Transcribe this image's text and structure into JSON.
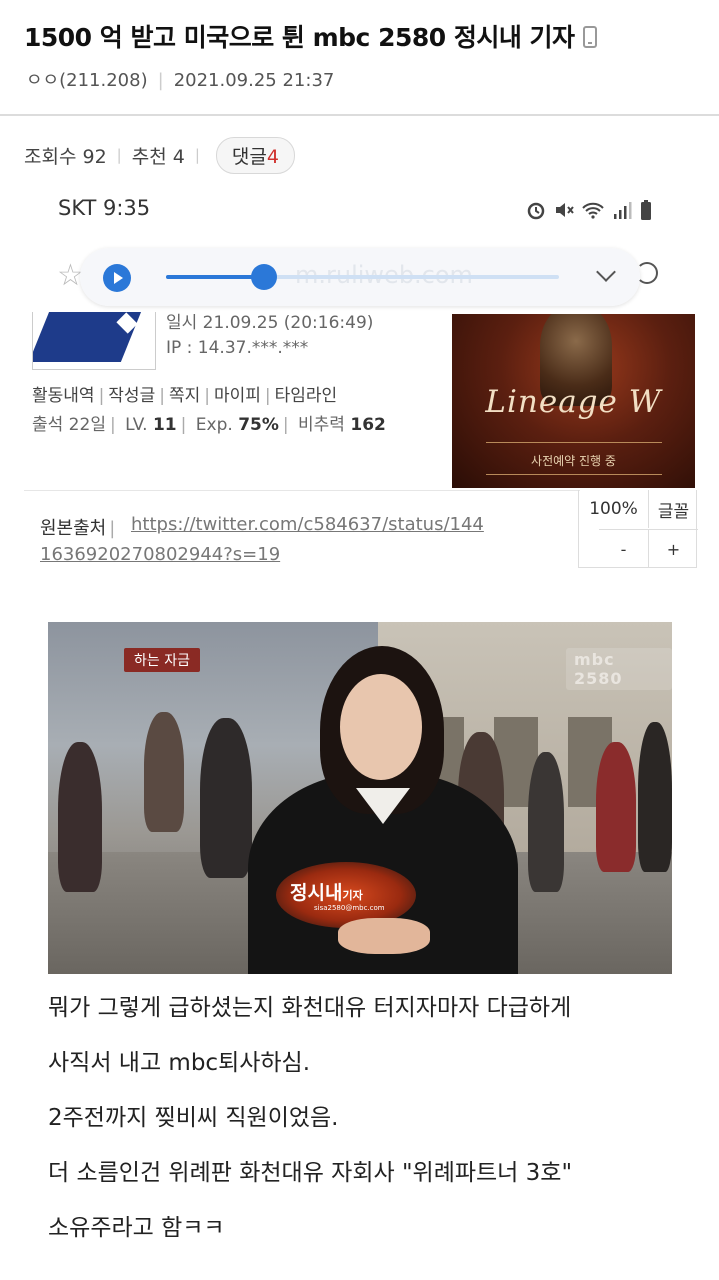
{
  "post": {
    "title": "1500 억 받고 미국으로 튄 mbc 2580 정시내 기자",
    "author": "ㅇㅇ(211.208)",
    "datetime": "2021.09.25 21:37",
    "views_label": "조회수 92",
    "recommend_label": "추천 4",
    "comment_label": "댓글",
    "comment_count": "4"
  },
  "embedded_screenshot": {
    "carrier_time": "SKT 9:35",
    "player": {
      "watermark": "m.ruliweb.com",
      "progress": 0.25
    },
    "profile": {
      "date": "일시 21.09.25 (20:16:49)",
      "ip": "IP : 14.37.***.***",
      "links": [
        "활동내역",
        "작성글",
        "쪽지",
        "마이피",
        "타임라인"
      ],
      "attendance": "출석 22일",
      "level_label": "LV.",
      "level": "11",
      "exp_label": "Exp.",
      "exp": "75%",
      "power_label": "비추력",
      "power": "162"
    },
    "ad": {
      "logo": "Lineage W",
      "subtext": "사전예약 진행 중"
    },
    "font_controls": {
      "zoom": "100%",
      "font": "글꼴",
      "minus": "-",
      "plus": "+"
    },
    "source": {
      "label": "원본출처",
      "url_line1": "https://twitter.com/c584637/status/144",
      "url_line2": "1636920270802944?s=19"
    }
  },
  "news_image": {
    "logo": "mbc 2580",
    "tag": "하는 자금",
    "caption_main": "정시내",
    "caption_small": "기자",
    "email": "sisa2580@mbc.com"
  },
  "body_lines": [
    "뭐가 그렇게 급하셨는지 화천대유 터지자마자 다급하게",
    "사직서 내고 mbc퇴사하심.",
    "2주전까지 찢비씨 직원이었음.",
    "더 소름인건 위례판 화천대유 자회사 \"위례파트너 3호\"",
    "소유주라고 함ㅋㅋ"
  ],
  "colors": {
    "accent": "#2b78d8",
    "comment_count": "#d0312d",
    "logo_blue": "#1e3b8a"
  }
}
